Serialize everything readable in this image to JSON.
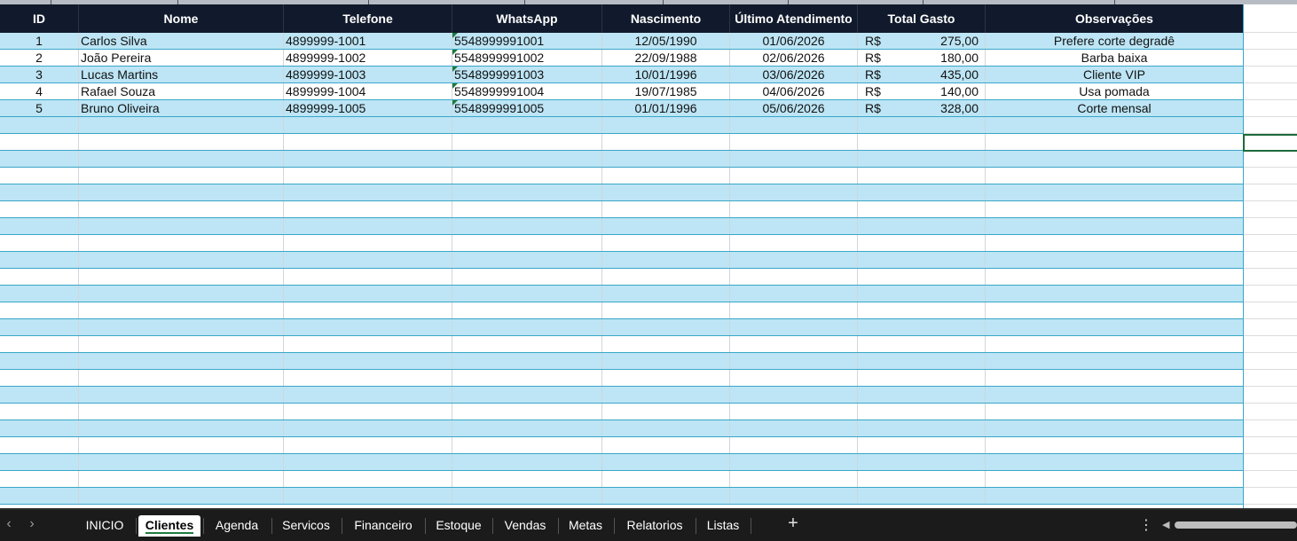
{
  "sheet": {
    "columns": [
      {
        "key": "id",
        "label": "ID",
        "align": "c"
      },
      {
        "key": "nome",
        "label": "Nome",
        "align": "l"
      },
      {
        "key": "telefone",
        "label": "Telefone",
        "align": "l"
      },
      {
        "key": "whatsapp",
        "label": "WhatsApp",
        "align": "l"
      },
      {
        "key": "nascimento",
        "label": "Nascimento",
        "align": "c"
      },
      {
        "key": "ultimo",
        "label": "Último Atendimento",
        "align": "c"
      },
      {
        "key": "total",
        "label": "Total Gasto",
        "align": "r"
      },
      {
        "key": "obs",
        "label": "Observações",
        "align": "c"
      }
    ],
    "currency_symbol": "R$",
    "rows": [
      {
        "id": "1",
        "nome": "Carlos Silva",
        "telefone": "4899999-1001",
        "whatsapp": "5548999991001",
        "nascimento": "12/05/1990",
        "ultimo": "01/06/2026",
        "total": "275,00",
        "obs": "Prefere corte degradê"
      },
      {
        "id": "2",
        "nome": "João Pereira",
        "telefone": "4899999-1002",
        "whatsapp": "5548999991002",
        "nascimento": "22/09/1988",
        "ultimo": "02/06/2026",
        "total": "180,00",
        "obs": "Barba baixa"
      },
      {
        "id": "3",
        "nome": "Lucas Martins",
        "telefone": "4899999-1003",
        "whatsapp": "5548999991003",
        "nascimento": "10/01/1996",
        "ultimo": "03/06/2026",
        "total": "435,00",
        "obs": "Cliente VIP"
      },
      {
        "id": "4",
        "nome": "Rafael Souza",
        "telefone": "4899999-1004",
        "whatsapp": "5548999991004",
        "nascimento": "19/07/1985",
        "ultimo": "04/06/2026",
        "total": "140,00",
        "obs": "Usa pomada"
      },
      {
        "id": "5",
        "nome": "Bruno Oliveira",
        "telefone": "4899999-1005",
        "whatsapp": "5548999991005",
        "nascimento": "01/01/1996",
        "ultimo": "05/06/2026",
        "total": "328,00",
        "obs": "Corte mensal"
      }
    ],
    "colors": {
      "header_bg": "#111a2c",
      "band_blue": "#bde5f5",
      "band_line": "#3aa6c8",
      "selection": "#1e6b3a"
    }
  },
  "tabs": {
    "items": [
      {
        "label": "INICIO",
        "active": false
      },
      {
        "label": "Clientes",
        "active": true
      },
      {
        "label": "Agenda",
        "active": false
      },
      {
        "label": "Servicos",
        "active": false
      },
      {
        "label": "Financeiro",
        "active": false
      },
      {
        "label": "Estoque",
        "active": false
      },
      {
        "label": "Vendas",
        "active": false
      },
      {
        "label": "Metas",
        "active": false
      },
      {
        "label": "Relatorios",
        "active": false
      },
      {
        "label": "Listas",
        "active": false
      }
    ],
    "prev_icon": "chevron-left-icon",
    "next_icon": "chevron-right-icon",
    "add_icon": "plus-icon",
    "more_icon": "vertical-ellipsis-icon"
  }
}
